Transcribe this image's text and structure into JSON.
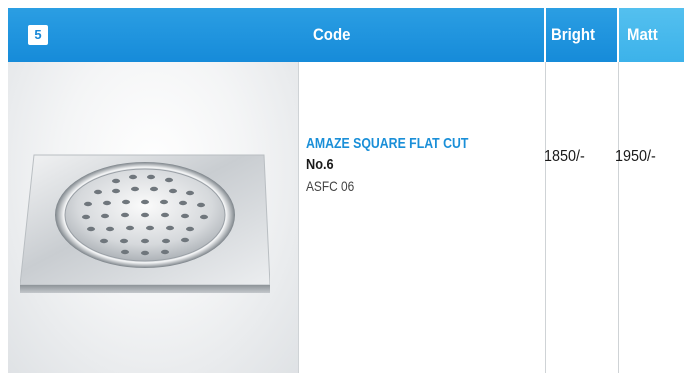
{
  "header": {
    "item_number": "5",
    "code_label": "Code",
    "bright_label": "Bright",
    "matt_label": "Matt"
  },
  "product": {
    "name": "AMAZE SQUARE FLAT CUT",
    "number": "No.6",
    "code": "ASFC 06",
    "price_bright": "1850/-",
    "price_matt": "1950/-"
  },
  "colors": {
    "header_blue": "#1e94dd",
    "matt_header_blue": "#45b7ec",
    "product_name_blue": "#1a8fd8"
  }
}
